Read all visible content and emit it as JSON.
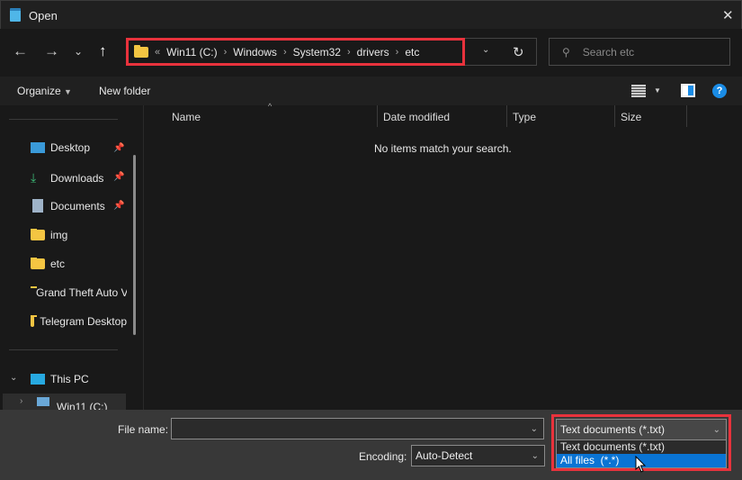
{
  "window": {
    "title": "Open",
    "close_label": "✕"
  },
  "nav": {
    "back": "←",
    "forward": "→",
    "recent": "⌄",
    "up": "↑",
    "refresh": "↻"
  },
  "address": {
    "overflow": "«",
    "crumbs": [
      "Win11 (C:)",
      "Windows",
      "System32",
      "drivers",
      "etc"
    ]
  },
  "search": {
    "placeholder": "Search etc"
  },
  "toolbar": {
    "organize": "Organize",
    "new_folder": "New folder"
  },
  "sidebar": {
    "items": [
      {
        "label": "Desktop",
        "icon": "desktop-icon",
        "pinned": true
      },
      {
        "label": "Downloads",
        "icon": "download-icon",
        "pinned": true
      },
      {
        "label": "Documents",
        "icon": "document-icon",
        "pinned": true
      },
      {
        "label": "img",
        "icon": "folder-icon",
        "pinned": false
      },
      {
        "label": "etc",
        "icon": "folder-icon",
        "pinned": false
      },
      {
        "label": "Grand Theft Auto V",
        "icon": "folder-icon",
        "pinned": false
      },
      {
        "label": "Telegram Desktop",
        "icon": "folder-icon",
        "pinned": false
      }
    ],
    "this_pc": "This PC",
    "drive": "Win11 (C:)"
  },
  "columns": [
    "Name",
    "Date modified",
    "Type",
    "Size"
  ],
  "empty_message": "No items match your search.",
  "bottom": {
    "file_name_label": "File name:",
    "file_name_value": "",
    "encoding_label": "Encoding:",
    "encoding_value": "Auto-Detect",
    "file_type_selected": "Text documents (*.txt)",
    "file_type_options": [
      "Text documents (*.txt)",
      "All files  (*.*)"
    ],
    "highlighted_option": 1
  },
  "colors": {
    "highlight": "#0a74d4",
    "annotation": "#e8323c"
  }
}
